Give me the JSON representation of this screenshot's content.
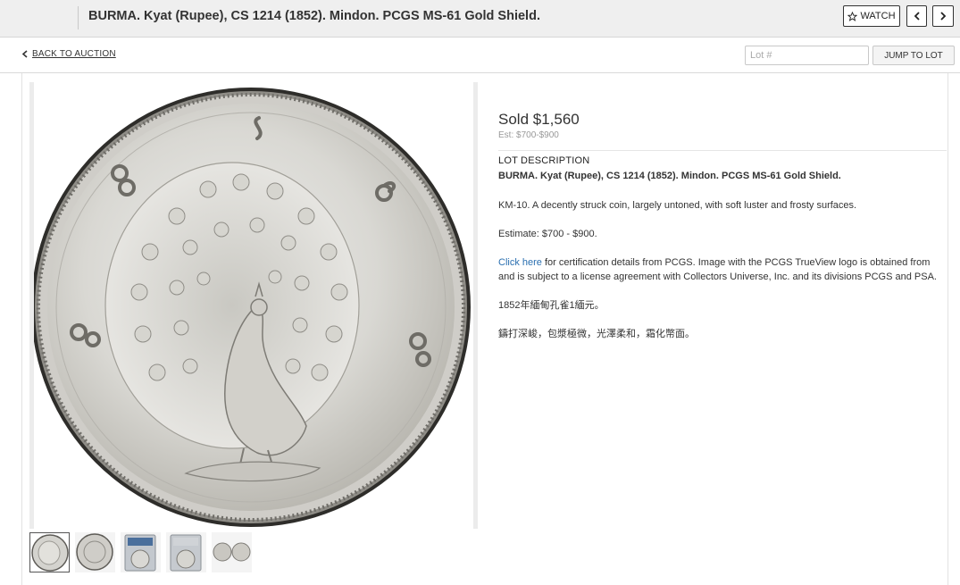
{
  "header": {
    "title": "BURMA. Kyat (Rupee), CS 1214 (1852). Mindon. PCGS MS-61 Gold Shield.",
    "watch_label": "WATCH",
    "watch_icon": "star-outline-icon",
    "prev_icon": "chevron-left-icon",
    "next_icon": "chevron-right-icon"
  },
  "subbar": {
    "back_label": "BACK TO AUCTION",
    "lot_placeholder": "Lot #",
    "jump_label": "JUMP TO LOT"
  },
  "lot": {
    "sold": "Sold $1,560",
    "estimate_short": "Est: $700-$900",
    "section_heading": "LOT DESCRIPTION",
    "title": "BURMA. Kyat (Rupee), CS 1214 (1852). Mindon. PCGS MS-61 Gold Shield.",
    "desc": "KM-10. A decently struck coin, largely untoned, with soft luster and frosty surfaces.",
    "estimate": "Estimate: $700 - $900.",
    "link_text": "Click here",
    "cert_text": " for certification details from PCGS. Image with the PCGS TrueView logo is obtained from and is subject to a license agreement with Collectors Universe, Inc. and its divisions PCGS and PSA.",
    "chinese_1": "1852年緬甸孔雀1緬元。",
    "chinese_2": "鑄打深峻，包漿極微，光澤柔和，霜化幣面。"
  },
  "gallery": {
    "main_image": "coin-peacock-obverse",
    "thumbnails": [
      "coin-obverse",
      "coin-reverse",
      "slab-front",
      "slab-back",
      "coin-pair"
    ],
    "active_index": 0
  },
  "colors": {
    "link": "#2a6fb0",
    "header_bg": "#efefef"
  }
}
